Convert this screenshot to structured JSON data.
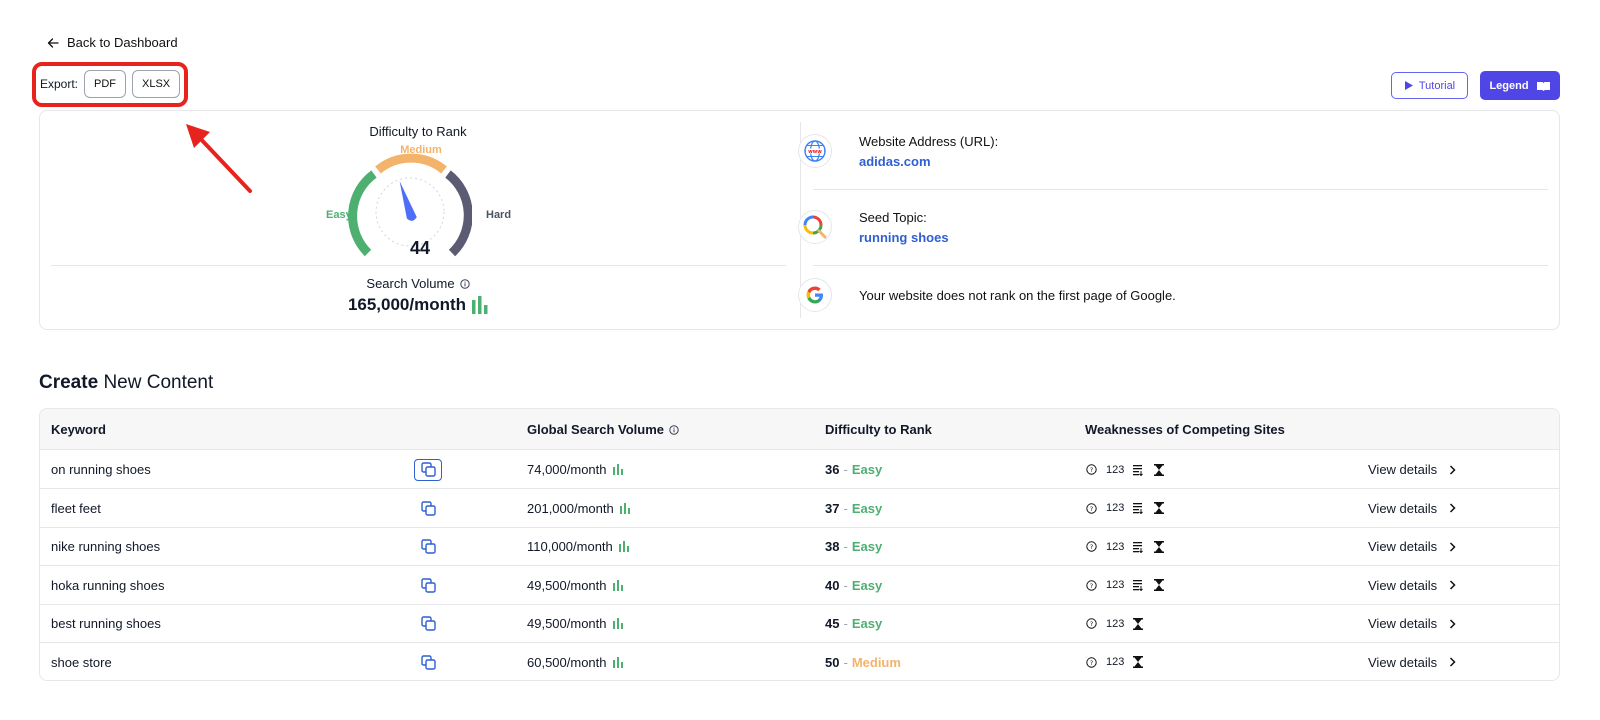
{
  "nav": {
    "back_label": "Back to Dashboard"
  },
  "export": {
    "label": "Export:",
    "pdf": "PDF",
    "xlsx": "XLSX"
  },
  "header_buttons": {
    "tutorial": "Tutorial",
    "legend": "Legend"
  },
  "difficulty": {
    "title": "Difficulty to Rank",
    "value": "44",
    "easy": "Easy",
    "medium": "Medium",
    "hard": "Hard",
    "level": 44
  },
  "search_volume": {
    "label": "Search Volume",
    "value": "165,000/month"
  },
  "website": {
    "label": "Website Address (URL):",
    "value": "adidas.com"
  },
  "seed": {
    "label": "Seed Topic:",
    "value": "running shoes"
  },
  "google_status": {
    "text": "Your website does not rank on the first page of Google."
  },
  "section": {
    "title_bold": "Create",
    "title_rest": "New Content"
  },
  "table": {
    "headers": {
      "keyword": "Keyword",
      "volume": "Global Search Volume",
      "difficulty": "Difficulty to Rank",
      "weaknesses": "Weaknesses of Competing Sites"
    },
    "rows": [
      {
        "keyword": "on running shoes",
        "volume": "74,000/month",
        "score": "36",
        "level": "Easy",
        "weak_num": "123",
        "view": "View details"
      },
      {
        "keyword": "fleet feet",
        "volume": "201,000/month",
        "score": "37",
        "level": "Easy",
        "weak_num": "123",
        "view": "View details"
      },
      {
        "keyword": "nike running shoes",
        "volume": "110,000/month",
        "score": "38",
        "level": "Easy",
        "weak_num": "123",
        "view": "View details"
      },
      {
        "keyword": "hoka running shoes",
        "volume": "49,500/month",
        "score": "40",
        "level": "Easy",
        "weak_num": "123",
        "view": "View details"
      },
      {
        "keyword": "best running shoes",
        "volume": "49,500/month",
        "score": "45",
        "level": "Easy",
        "weak_num": "123",
        "view": "View details"
      },
      {
        "keyword": "shoe store",
        "volume": "60,500/month",
        "score": "50",
        "level": "Medium",
        "weak_num": "123",
        "view": "View details"
      }
    ]
  },
  "colors": {
    "accent": "#4f46e5",
    "link": "#2f5fd1",
    "easy": "#4db070",
    "medium": "#f4b36b",
    "highlight": "#e8231d"
  }
}
